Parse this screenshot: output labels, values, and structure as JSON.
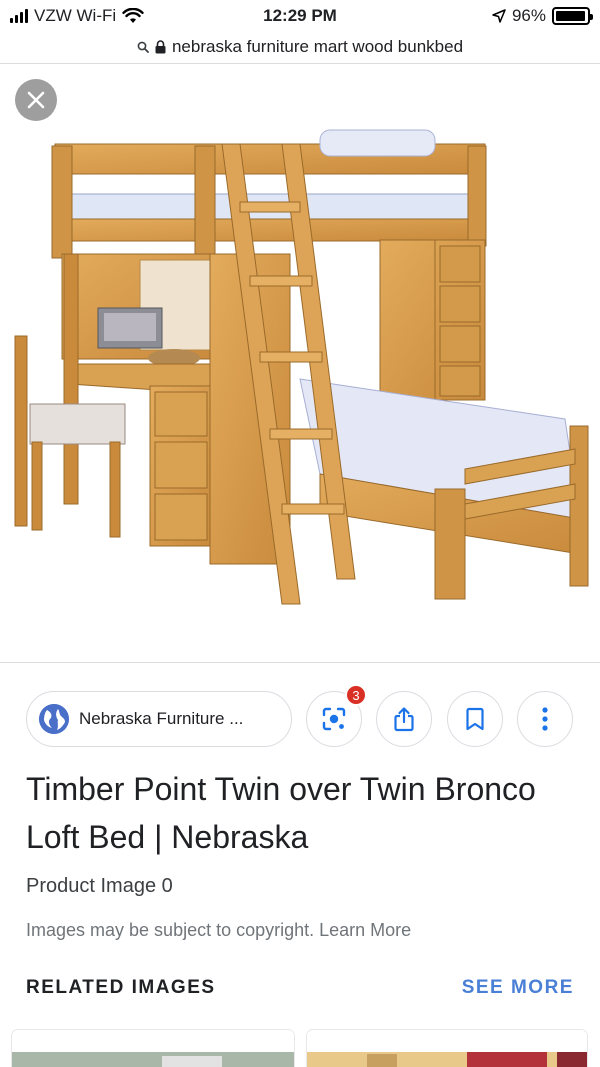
{
  "status": {
    "carrier": "VZW Wi-Fi",
    "time": "12:29 PM",
    "battery": "96%",
    "battery_level": 0.96
  },
  "url_bar": {
    "text": "nebraska furniture mart wood bunkbed"
  },
  "source": {
    "label": "Nebraska Furniture ..."
  },
  "actions": {
    "lens_badge": "3"
  },
  "result": {
    "title": "Timber Point Twin over Twin Bronco Loft Bed | Nebraska",
    "subtitle": "Product Image 0",
    "copyright": "Images may be subject to copyright. Learn More"
  },
  "related": {
    "label": "RELATED IMAGES",
    "see_more": "SEE MORE"
  },
  "colors": {
    "accent": "#4a7fd6",
    "badge": "#d93025",
    "wood": "#d9a152"
  },
  "icons": [
    "signal-icon",
    "wifi-icon",
    "location-arrow-icon",
    "battery-icon",
    "search-icon",
    "lock-icon",
    "close-icon",
    "globe-icon",
    "lens-icon",
    "share-icon",
    "bookmark-icon",
    "more-vert-icon"
  ]
}
